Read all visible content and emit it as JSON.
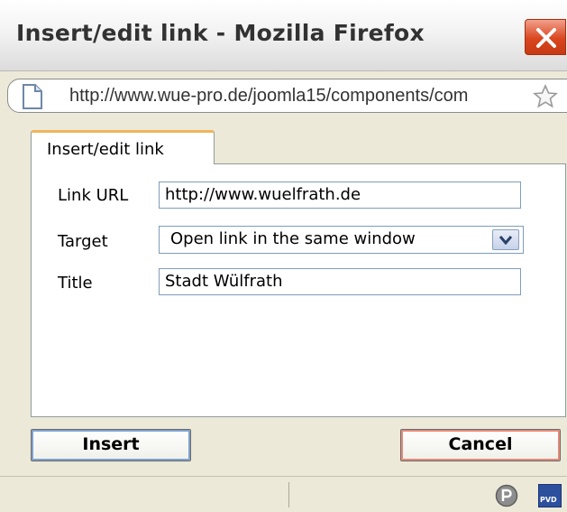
{
  "window": {
    "title": "Insert/edit link - Mozilla Firefox",
    "url": "http://www.wue-pro.de/joomla15/components/com"
  },
  "dialog": {
    "tab_label": "Insert/edit link",
    "fields": {
      "link_url": {
        "label": "Link URL",
        "value": "http://www.wuelfrath.de"
      },
      "target": {
        "label": "Target",
        "value": "Open link in the same window"
      },
      "title": {
        "label": "Title",
        "value": "Stadt Wülfrath"
      }
    },
    "buttons": {
      "insert": "Insert",
      "cancel": "Cancel"
    }
  },
  "status": {
    "badge_pvd": "PVD"
  },
  "colors": {
    "tab_accent": "#f0b45c",
    "insert_border": "#7da2ce",
    "cancel_border": "#e48a7a",
    "close_button": "#d9461f"
  },
  "icons": [
    "close-icon",
    "page-icon",
    "bookmark-star-icon",
    "dropdown-arrow-icon",
    "status-p-icon",
    "status-pvd-icon"
  ]
}
